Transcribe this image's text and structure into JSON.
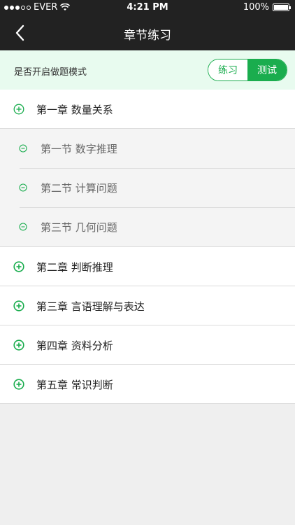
{
  "status": {
    "carrier": "EVER",
    "time": "4:21 PM",
    "battery": "100%",
    "signal_bars": 3,
    "signal_total": 5
  },
  "nav": {
    "title": "章节练习",
    "back_icon": "chevron-left-icon"
  },
  "mode": {
    "label": "是否开启做题模式",
    "practice": "练习",
    "test": "测试",
    "selected": "test"
  },
  "chapters": [
    {
      "title": "第一章  数量关系",
      "expanded": true,
      "sections": [
        "第一节  数字推理",
        "第二节  计算问题",
        "第三节  几何问题"
      ]
    },
    {
      "title": "第二章  判断推理",
      "expanded": false
    },
    {
      "title": "第三章  言语理解与表达",
      "expanded": false
    },
    {
      "title": "第四章  资料分析",
      "expanded": false
    },
    {
      "title": "第五章  常识判断",
      "expanded": false
    }
  ],
  "colors": {
    "accent": "#1aad4e",
    "bar": "#222222",
    "mode_bg": "#e8fbef"
  }
}
